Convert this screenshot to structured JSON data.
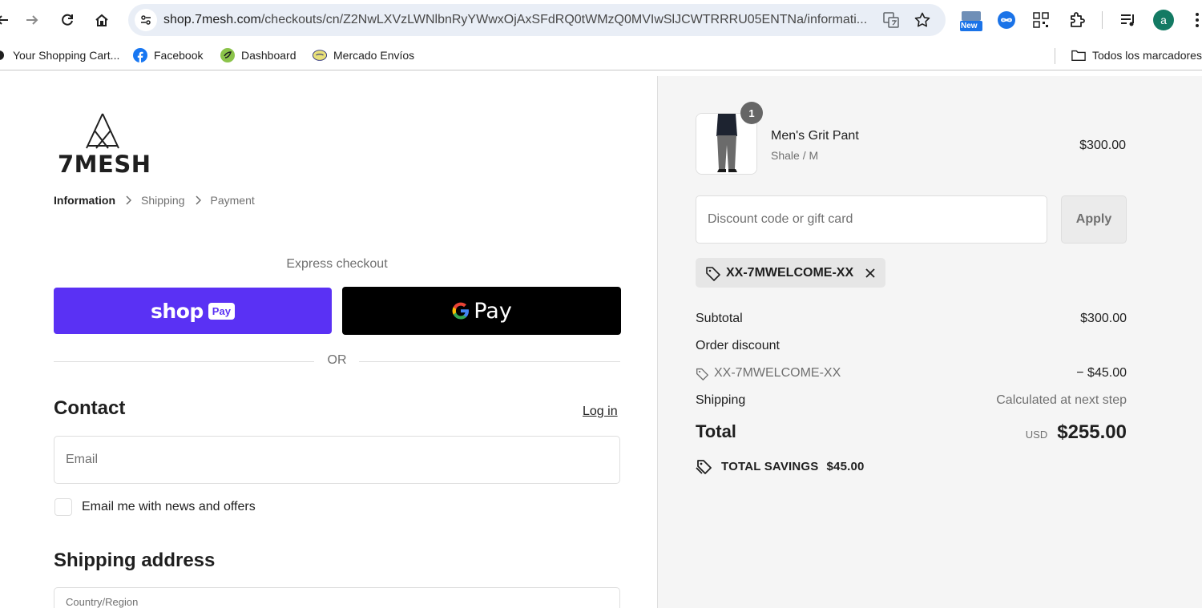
{
  "browser": {
    "url_host": "shop.7mesh.com",
    "url_path": "/checkouts/cn/Z2NwLXVzLWNlbnRyYWwxOjAxSFdRQ0tWMzQ0MVIwSlJCWTRRRU05ENTNa/informati..."
  },
  "bookmarks": {
    "items": [
      "Your Shopping Cart...",
      "Facebook",
      "Dashboard",
      "Mercado Envíos"
    ],
    "all_bookmarks": "Todos los marcadores"
  },
  "extensions": {
    "new_badge": "New",
    "profile_initial": "a"
  },
  "checkout": {
    "brand": "7MESH",
    "breadcrumbs": [
      "Information",
      "Shipping",
      "Payment"
    ],
    "express_title": "Express checkout",
    "shoppay_word": "shop",
    "shoppay_tag": "Pay",
    "gpay_word": "Pay",
    "or_text": "OR",
    "contact_heading": "Contact",
    "login_link": "Log in",
    "email_placeholder": "Email",
    "newsletter_label": "Email me with news and offers",
    "shipping_heading": "Shipping address",
    "country_label": "Country/Region"
  },
  "summary": {
    "product": {
      "quantity": "1",
      "name": "Men's Grit Pant",
      "variant": "Shale / M",
      "price": "$300.00"
    },
    "discount_placeholder": "Discount code or gift card",
    "apply_label": "Apply",
    "applied_code": "XX-7MWELCOME-XX",
    "subtotal_label": "Subtotal",
    "subtotal_value": "$300.00",
    "order_discount_label": "Order discount",
    "discount_code": "XX-7MWELCOME-XX",
    "discount_value": "− $45.00",
    "shipping_label": "Shipping",
    "shipping_value": "Calculated at next step",
    "total_label": "Total",
    "total_currency": "USD",
    "total_value": "$255.00",
    "savings_label": "TOTAL SAVINGS",
    "savings_value": "$45.00"
  },
  "colors": {
    "shop_pay": "#5a31f4",
    "gpay": "#000000",
    "summary_bg": "#f5f5f5"
  }
}
